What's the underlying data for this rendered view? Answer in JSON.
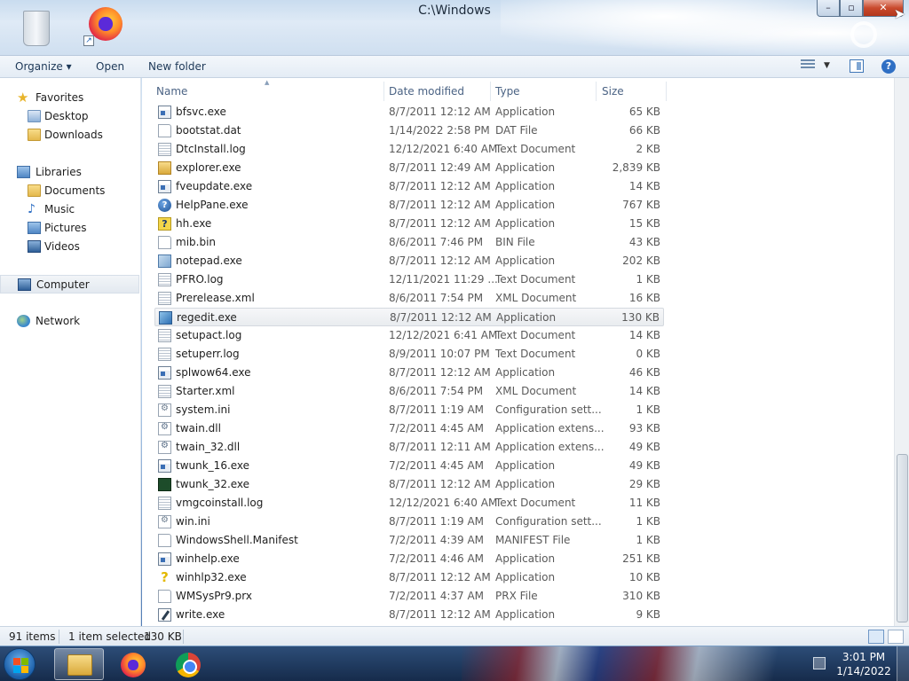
{
  "window": {
    "title": "C:\\Windows"
  },
  "toolbar": {
    "organize": "Organize ▾",
    "open": "Open",
    "new_folder": "New folder"
  },
  "nav": {
    "favorites": "Favorites",
    "desktop": "Desktop",
    "downloads": "Downloads",
    "libraries": "Libraries",
    "documents": "Documents",
    "music": "Music",
    "pictures": "Pictures",
    "videos": "Videos",
    "computer": "Computer",
    "network": "Network"
  },
  "columns": {
    "name": "Name",
    "date": "Date modified",
    "type": "Type",
    "size": "Size"
  },
  "files": [
    {
      "name": "bfsvc.exe",
      "date": "8/7/2011 12:12 AM",
      "type": "Application",
      "size": "65 KB",
      "icon": "app-icon"
    },
    {
      "name": "bootstat.dat",
      "date": "1/14/2022 2:58 PM",
      "type": "DAT File",
      "size": "66 KB",
      "icon": "file-icon"
    },
    {
      "name": "DtcInstall.log",
      "date": "12/12/2021 6:40 AM",
      "type": "Text Document",
      "size": "2 KB",
      "icon": "text-document-icon"
    },
    {
      "name": "explorer.exe",
      "date": "8/7/2011 12:49 AM",
      "type": "Application",
      "size": "2,839 KB",
      "icon": "explorer-icon"
    },
    {
      "name": "fveupdate.exe",
      "date": "8/7/2011 12:12 AM",
      "type": "Application",
      "size": "14 KB",
      "icon": "app-icon"
    },
    {
      "name": "HelpPane.exe",
      "date": "8/7/2011 12:12 AM",
      "type": "Application",
      "size": "767 KB",
      "icon": "help-icon"
    },
    {
      "name": "hh.exe",
      "date": "8/7/2011 12:12 AM",
      "type": "Application",
      "size": "15 KB",
      "icon": "help-document-icon"
    },
    {
      "name": "mib.bin",
      "date": "8/6/2011 7:46 PM",
      "type": "BIN File",
      "size": "43 KB",
      "icon": "file-icon"
    },
    {
      "name": "notepad.exe",
      "date": "8/7/2011 12:12 AM",
      "type": "Application",
      "size": "202 KB",
      "icon": "notepad-icon"
    },
    {
      "name": "PFRO.log",
      "date": "12/11/2021 11:29 ...",
      "type": "Text Document",
      "size": "1 KB",
      "icon": "text-document-icon"
    },
    {
      "name": "Prerelease.xml",
      "date": "8/6/2011 7:54 PM",
      "type": "XML Document",
      "size": "16 KB",
      "icon": "text-document-icon"
    },
    {
      "name": "regedit.exe",
      "date": "8/7/2011 12:12 AM",
      "type": "Application",
      "size": "130 KB",
      "icon": "regedit-icon"
    },
    {
      "name": "setupact.log",
      "date": "12/12/2021 6:41 AM",
      "type": "Text Document",
      "size": "14 KB",
      "icon": "text-document-icon"
    },
    {
      "name": "setuperr.log",
      "date": "8/9/2011 10:07 PM",
      "type": "Text Document",
      "size": "0 KB",
      "icon": "text-document-icon"
    },
    {
      "name": "splwow64.exe",
      "date": "8/7/2011 12:12 AM",
      "type": "Application",
      "size": "46 KB",
      "icon": "app-icon"
    },
    {
      "name": "Starter.xml",
      "date": "8/6/2011 7:54 PM",
      "type": "XML Document",
      "size": "14 KB",
      "icon": "text-document-icon"
    },
    {
      "name": "system.ini",
      "date": "8/7/2011 1:19 AM",
      "type": "Configuration sett...",
      "size": "1 KB",
      "icon": "config-file-icon"
    },
    {
      "name": "twain.dll",
      "date": "7/2/2011 4:45 AM",
      "type": "Application extens...",
      "size": "93 KB",
      "icon": "dll-icon"
    },
    {
      "name": "twain_32.dll",
      "date": "8/7/2011 12:11 AM",
      "type": "Application extens...",
      "size": "49 KB",
      "icon": "dll-icon"
    },
    {
      "name": "twunk_16.exe",
      "date": "7/2/2011 4:45 AM",
      "type": "Application",
      "size": "49 KB",
      "icon": "app-icon"
    },
    {
      "name": "twunk_32.exe",
      "date": "8/7/2011 12:12 AM",
      "type": "Application",
      "size": "29 KB",
      "icon": "twunk-icon"
    },
    {
      "name": "vmgcoinstall.log",
      "date": "12/12/2021 6:40 AM",
      "type": "Text Document",
      "size": "11 KB",
      "icon": "text-document-icon"
    },
    {
      "name": "win.ini",
      "date": "8/7/2011 1:19 AM",
      "type": "Configuration sett...",
      "size": "1 KB",
      "icon": "config-file-icon"
    },
    {
      "name": "WindowsShell.Manifest",
      "date": "7/2/2011 4:39 AM",
      "type": "MANIFEST File",
      "size": "1 KB",
      "icon": "file-icon"
    },
    {
      "name": "winhelp.exe",
      "date": "7/2/2011 4:46 AM",
      "type": "Application",
      "size": "251 KB",
      "icon": "app-icon"
    },
    {
      "name": "winhlp32.exe",
      "date": "8/7/2011 12:12 AM",
      "type": "Application",
      "size": "10 KB",
      "icon": "question-icon"
    },
    {
      "name": "WMSysPr9.prx",
      "date": "7/2/2011 4:37 AM",
      "type": "PRX File",
      "size": "310 KB",
      "icon": "file-icon"
    },
    {
      "name": "write.exe",
      "date": "8/7/2011 12:12 AM",
      "type": "Application",
      "size": "9 KB",
      "icon": "write-icon"
    }
  ],
  "selected_index": 11,
  "status": {
    "count": "91 items",
    "selection": "1 item selected",
    "size": "130 KB"
  },
  "clock": {
    "time": "3:01 PM",
    "date": "1/14/2022"
  },
  "colors": {
    "accent": "#2f6fc4",
    "titlebar": "#cfdff0",
    "close": "#c94a2d"
  }
}
